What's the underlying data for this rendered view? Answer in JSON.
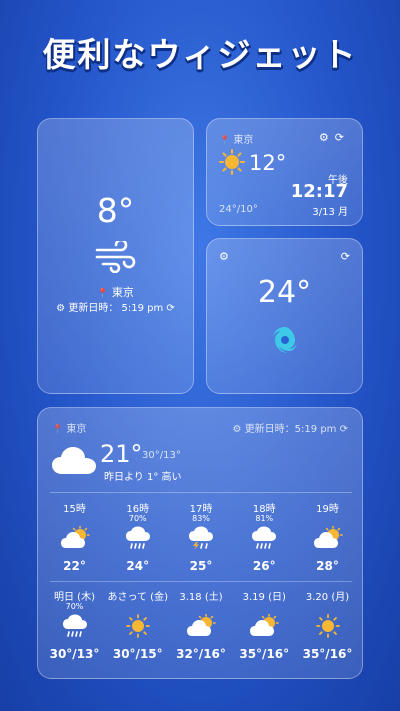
{
  "headline": "便利なウィジェット",
  "widget_large": {
    "temperature": "8°",
    "location": "東京",
    "updated": "更新日時： 5:19 pm",
    "icon": "wind-icon"
  },
  "widget_clock": {
    "location": "東京",
    "temperature": "12°",
    "range": "24°/10°",
    "ampm": "午後",
    "time": "12:17",
    "date": "3/13 月",
    "icon": "sun-icon"
  },
  "widget_storm": {
    "temperature": "24°",
    "icon": "hurricane-icon"
  },
  "widget_forecast": {
    "location": "東京",
    "updated": "更新日時：5:19 pm",
    "current_temp": "21°",
    "high_low": "30°/13°",
    "comparison": "昨日より 1° 高い",
    "hourly": [
      {
        "time": "15時",
        "pop": "",
        "icon": "partly-cloudy",
        "temp": "22°"
      },
      {
        "time": "16時",
        "pop": "70%",
        "icon": "rain",
        "temp": "24°"
      },
      {
        "time": "17時",
        "pop": "83%",
        "icon": "thunderstorm",
        "temp": "25°"
      },
      {
        "time": "18時",
        "pop": "81%",
        "icon": "rain",
        "temp": "26°"
      },
      {
        "time": "19時",
        "pop": "",
        "icon": "partly-cloudy",
        "temp": "28°"
      }
    ],
    "daily": [
      {
        "day": "明日 (木)",
        "pop": "70%",
        "icon": "rain",
        "temp": "30°/13°"
      },
      {
        "day": "あさって (金)",
        "pop": "",
        "icon": "sunny",
        "temp": "30°/15°"
      },
      {
        "day": "3.18 (土)",
        "pop": "",
        "icon": "partly-cloudy",
        "temp": "32°/16°"
      },
      {
        "day": "3.19 (日)",
        "pop": "",
        "icon": "partly-cloudy",
        "temp": "35°/16°"
      },
      {
        "day": "3.20 (月)",
        "pop": "",
        "icon": "sunny",
        "temp": "35°/16°"
      }
    ]
  },
  "glyphs": {
    "pin": "⬤",
    "gear": "⚙",
    "refresh": "⟳"
  },
  "colors": {
    "background": "#2354c8",
    "sun": "#f7b733",
    "hurricane": "#3ec9e8"
  }
}
